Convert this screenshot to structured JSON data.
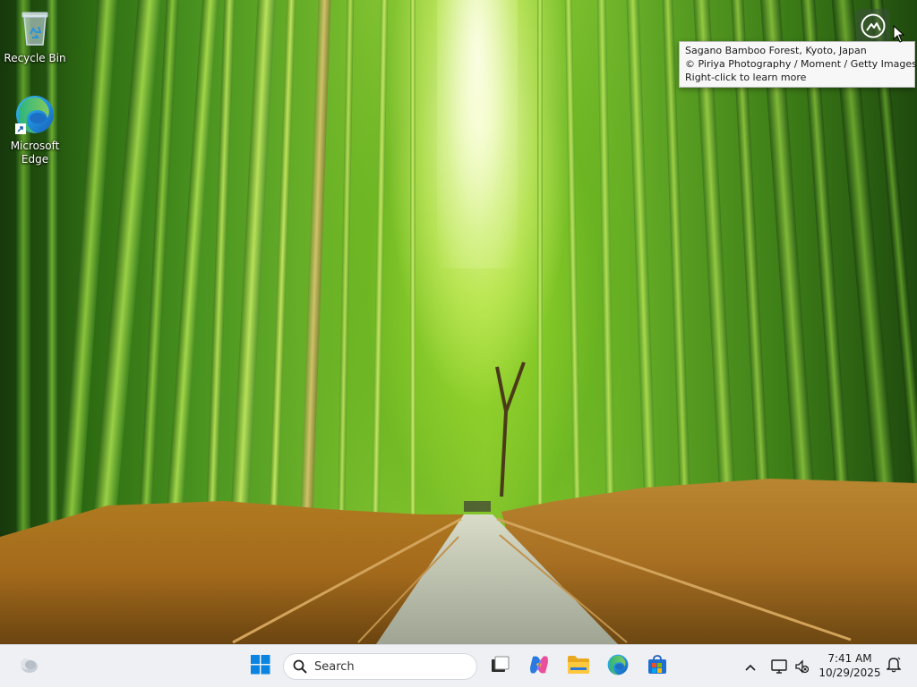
{
  "desktop": {
    "icons": [
      {
        "label": "Recycle Bin",
        "icon": "recycle-bin-icon"
      },
      {
        "label": "Microsoft\nEdge",
        "icon": "edge-icon"
      }
    ]
  },
  "spotlight": {
    "icon": "spotlight-learn-more-icon",
    "tooltip": {
      "line1": "Sagano Bamboo Forest, Kyoto, Japan",
      "line2": "© Piriya Photography / Moment / Getty Images",
      "line3": "Right-click to learn more"
    }
  },
  "taskbar": {
    "widgets_icon": "weather-widget-icon",
    "start_icon": "windows-start-icon",
    "search": {
      "placeholder": "Search",
      "icon": "search-icon"
    },
    "pinned": [
      {
        "name": "task-view",
        "icon": "task-view-icon"
      },
      {
        "name": "copilot",
        "icon": "copilot-icon"
      },
      {
        "name": "file-explorer",
        "icon": "folder-icon"
      },
      {
        "name": "edge",
        "icon": "edge-icon"
      },
      {
        "name": "microsoft-store",
        "icon": "store-icon"
      }
    ],
    "tray": {
      "chevron_icon": "chevron-up-icon",
      "network_icon": "network-icon",
      "volume_icon": "volume-muted-icon",
      "time": "7:41 AM",
      "date": "10/29/2025",
      "notification_icon": "notification-bell-icon"
    }
  },
  "colors": {
    "taskbar_bg": "#eef0f3",
    "windows_blue": "#0078d4",
    "tooltip_bg": "#f7f7f7"
  }
}
